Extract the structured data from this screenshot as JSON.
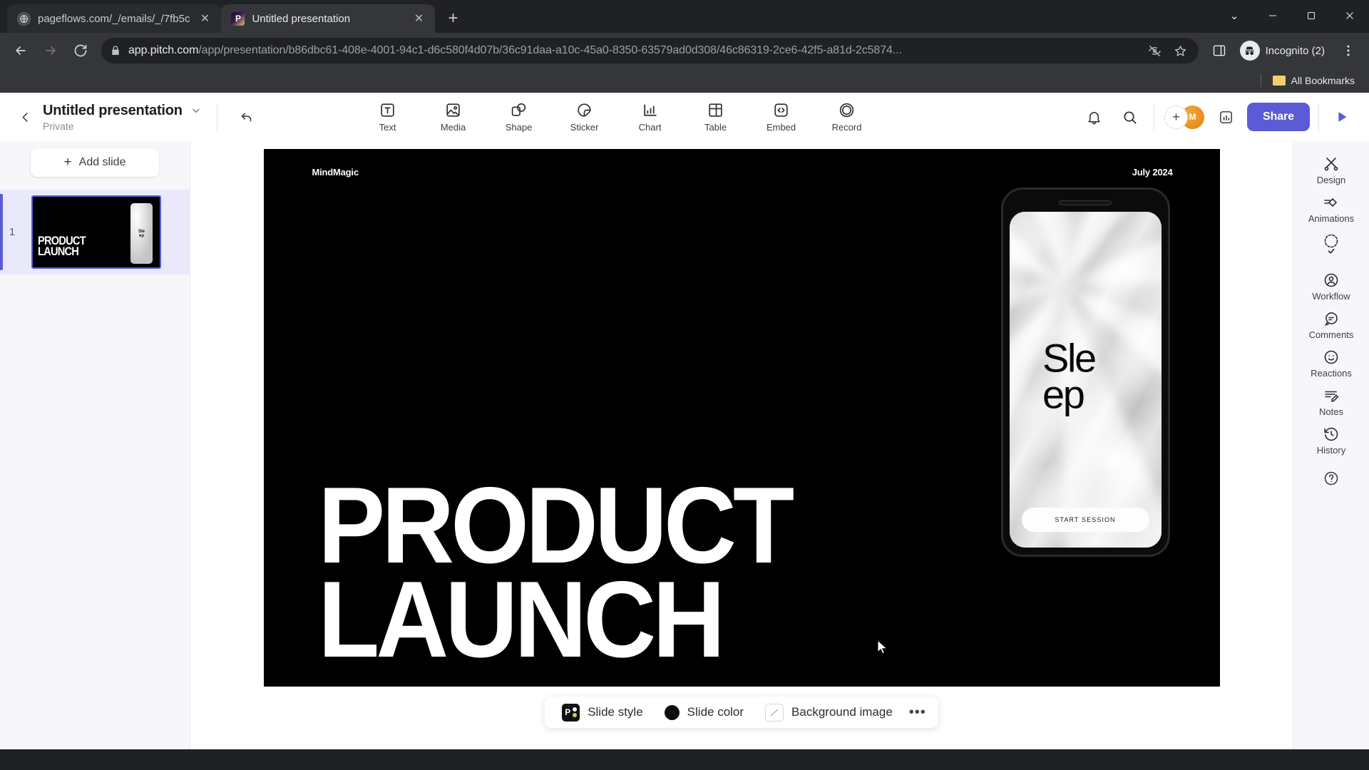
{
  "browser": {
    "tabs": [
      {
        "title": "pageflows.com/_/emails/_/7fb5c",
        "favicon": "globe-icon",
        "active": false,
        "close_label": "✕"
      },
      {
        "title": "Untitled presentation",
        "favicon": "pitch-logo-icon",
        "active": true,
        "close_label": "✕"
      }
    ],
    "new_tab_label": "+",
    "window_controls": {
      "minimize": "─",
      "maximize": "☐",
      "close": "✕",
      "expand": "⌄"
    },
    "url": {
      "host": "app.pitch.com",
      "path": "/app/presentation/b86dbc61-408e-4001-94c1-d6c580f4d07b/36c91daa-a10c-45a0-8350-63579ad0d308/46c86319-2ce6-42f5-a81d-2c5874..."
    },
    "profile_label": "Incognito (2)",
    "bookmarks": {
      "all_bookmarks_label": "All Bookmarks"
    }
  },
  "app": {
    "title": "Untitled presentation",
    "visibility": "Private",
    "tools": [
      {
        "label": "Text",
        "icon": "text-icon"
      },
      {
        "label": "Media",
        "icon": "media-icon"
      },
      {
        "label": "Shape",
        "icon": "shape-icon"
      },
      {
        "label": "Sticker",
        "icon": "sticker-icon"
      },
      {
        "label": "Chart",
        "icon": "chart-icon"
      },
      {
        "label": "Table",
        "icon": "table-icon"
      },
      {
        "label": "Embed",
        "icon": "embed-icon"
      },
      {
        "label": "Record",
        "icon": "record-icon"
      }
    ],
    "add_person_label": "+",
    "avatar_initials": "M",
    "share_label": "Share",
    "accent_color": "#5b5bd6"
  },
  "slides_panel": {
    "add_slide_label": "Add slide",
    "add_slide_plus": "+",
    "slides": [
      {
        "number": "1",
        "title": "PRODUCT\nLAUNCH",
        "phone_word": "Sle\nep"
      }
    ]
  },
  "slide": {
    "brand": "MindMagic",
    "date": "July 2024",
    "headline": "PRODUCT\nLAUNCH",
    "phone": {
      "word": "Sle\nep",
      "cta": "START SESSION"
    },
    "background_color": "#000000",
    "text_color": "#ffffff"
  },
  "stylebar": {
    "slide_style_label": "Slide style",
    "slide_color_label": "Slide color",
    "background_image_label": "Background image",
    "more_label": "•••",
    "slide_color_value": "#0d0d0d",
    "style_badge_letter": "P"
  },
  "right_rail": [
    {
      "label": "Design",
      "icons": [
        "scissors-brush-icon"
      ]
    },
    {
      "label": "Animations",
      "icons": [
        "animation-diamond-icon"
      ]
    },
    {
      "label": "Workflow",
      "icons": [
        "check-circle-icon",
        "person-circle-icon"
      ]
    },
    {
      "label": "Comments",
      "icons": [
        "comment-bubble-icon"
      ]
    },
    {
      "label": "Reactions",
      "icons": [
        "smiley-icon"
      ]
    },
    {
      "label": "Notes",
      "icons": [
        "notes-pencil-icon"
      ]
    },
    {
      "label": "History",
      "icons": [
        "history-clock-icon"
      ]
    }
  ],
  "help_label": "?"
}
